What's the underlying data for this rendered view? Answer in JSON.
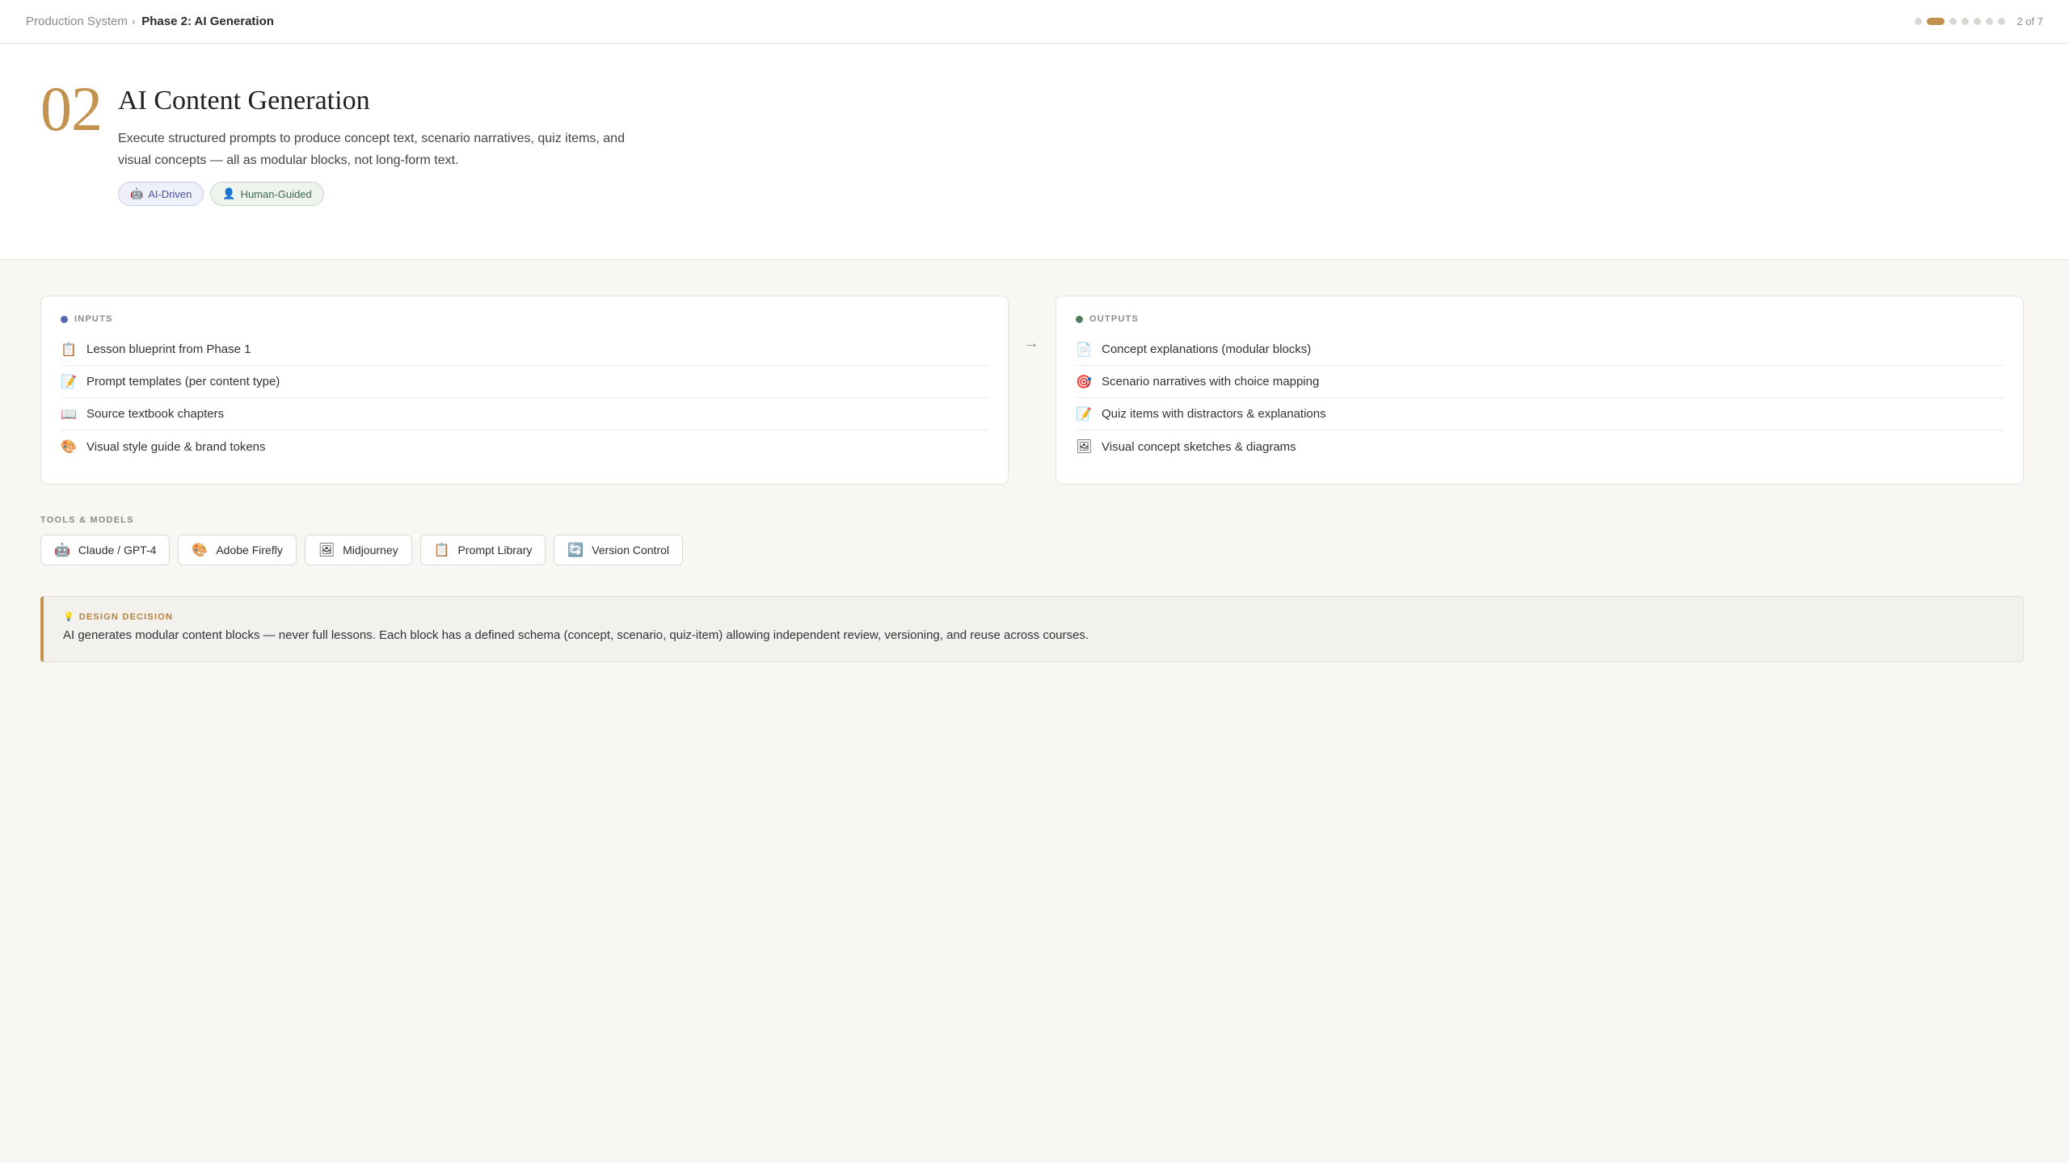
{
  "breadcrumb": {
    "root": "Production System",
    "separator": "›",
    "current": "Phase 2: AI Generation"
  },
  "progress": {
    "total_steps": 7,
    "current_step": 2,
    "label": "2 of 7",
    "accent_color": "#c2924e"
  },
  "hero": {
    "number": "02",
    "title": "AI Content Generation",
    "description": "Execute structured prompts to produce concept text, scenario narratives, quiz items, and visual concepts — all as modular blocks, not long-form text.",
    "tags": [
      {
        "icon": "robot-icon",
        "glyph": "🤖",
        "label": "AI-Driven"
      },
      {
        "icon": "person-icon",
        "glyph": "👤",
        "label": "Human-Guided"
      }
    ]
  },
  "inputs": {
    "label": "INPUTS",
    "items": [
      {
        "icon": "clipboard-icon",
        "glyph": "📋",
        "label": "Lesson blueprint from Phase 1"
      },
      {
        "icon": "memo-icon",
        "glyph": "📝",
        "label": "Prompt templates (per content type)"
      },
      {
        "icon": "book-icon",
        "glyph": "📖",
        "label": "Source textbook chapters"
      },
      {
        "icon": "palette-icon",
        "glyph": "🎨",
        "label": "Visual style guide & brand tokens"
      }
    ]
  },
  "outputs": {
    "label": "OUTPUTS",
    "items": [
      {
        "icon": "document-icon",
        "glyph": "📄",
        "label": "Concept explanations (modular blocks)"
      },
      {
        "icon": "target-icon",
        "glyph": "🎯",
        "label": "Scenario narratives with choice mapping"
      },
      {
        "icon": "memo-icon",
        "glyph": "📝",
        "label": "Quiz items with distractors & explanations"
      },
      {
        "icon": "picture-icon",
        "glyph": "🖼",
        "label": "Visual concept sketches & diagrams"
      }
    ]
  },
  "tools": {
    "label": "TOOLS & MODELS",
    "items": [
      {
        "icon": "robot-icon",
        "glyph": "🤖",
        "label": "Claude / GPT-4"
      },
      {
        "icon": "palette-icon",
        "glyph": "🎨",
        "label": "Adobe Firefly"
      },
      {
        "icon": "picture-icon",
        "glyph": "🖼",
        "label": "Midjourney"
      },
      {
        "icon": "clipboard-icon",
        "glyph": "📋",
        "label": "Prompt Library"
      },
      {
        "icon": "refresh-icon",
        "glyph": "🔄",
        "label": "Version Control"
      }
    ]
  },
  "decision": {
    "icon": "lightbulb-icon",
    "glyph": "💡",
    "label": "DESIGN DECISION",
    "text": "AI generates modular content blocks — never full lessons. Each block has a defined schema (concept, scenario, quiz-item) allowing independent review, versioning, and reuse across courses."
  }
}
